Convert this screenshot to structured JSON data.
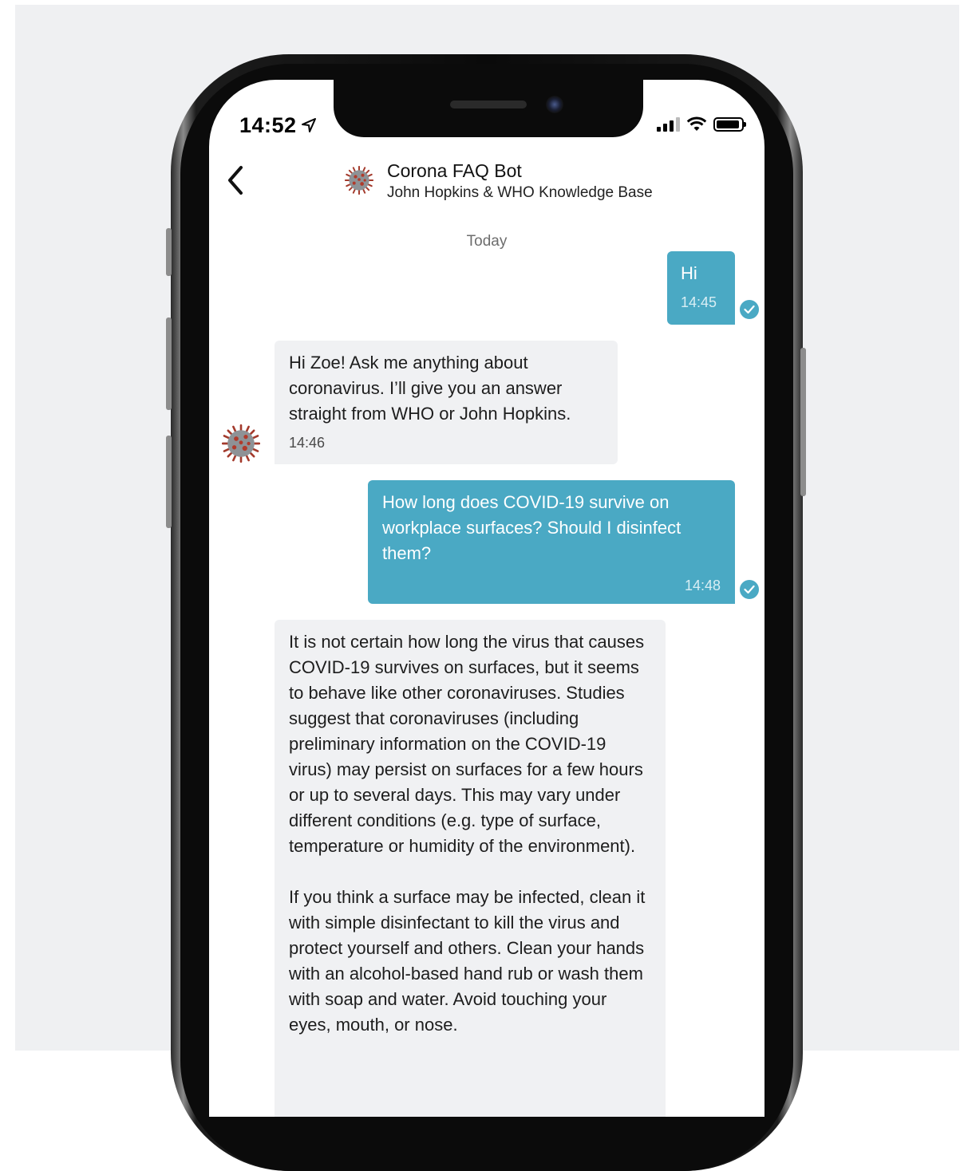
{
  "status_bar": {
    "time": "14:52"
  },
  "header": {
    "back_icon": "chevron-left-icon",
    "title": "Corona FAQ Bot",
    "subtitle": "John Hopkins & WHO Knowledge Base"
  },
  "chat": {
    "date_separator": "Today",
    "messages": [
      {
        "direction": "outgoing",
        "text": "Hi",
        "time": "14:45",
        "status": "read"
      },
      {
        "direction": "incoming",
        "text": "Hi Zoe! Ask me anything about coronavirus. I’ll give you an answer straight from WHO or John Hopkins.",
        "time": "14:46"
      },
      {
        "direction": "outgoing",
        "text": "How long does COVID-19 survive on workplace surfaces? Should I disinfect them?",
        "time": "14:48",
        "status": "read"
      },
      {
        "direction": "incoming",
        "paragraphs": [
          "It is not certain how long the virus that causes COVID-19 survives on surfaces, but it seems to behave like other coronaviruses. Studies suggest that coronaviruses (including preliminary information on the COVID-19 virus) may persist on surfaces for a few hours or up to several days. This may vary under different conditions (e.g. type of surface, temperature or humidity of the environment).",
          "If you think a surface may be infected, clean it with simple disinfectant to kill the virus and protect yourself and others. Clean your hands with an alcohol-based hand rub or wash them with soap and water. Avoid touching your eyes, mouth, or nose."
        ]
      }
    ]
  },
  "colors": {
    "outgoing_bubble": "#4aa9c4",
    "incoming_bubble": "#f0f1f3",
    "background": "#eff0f2"
  }
}
